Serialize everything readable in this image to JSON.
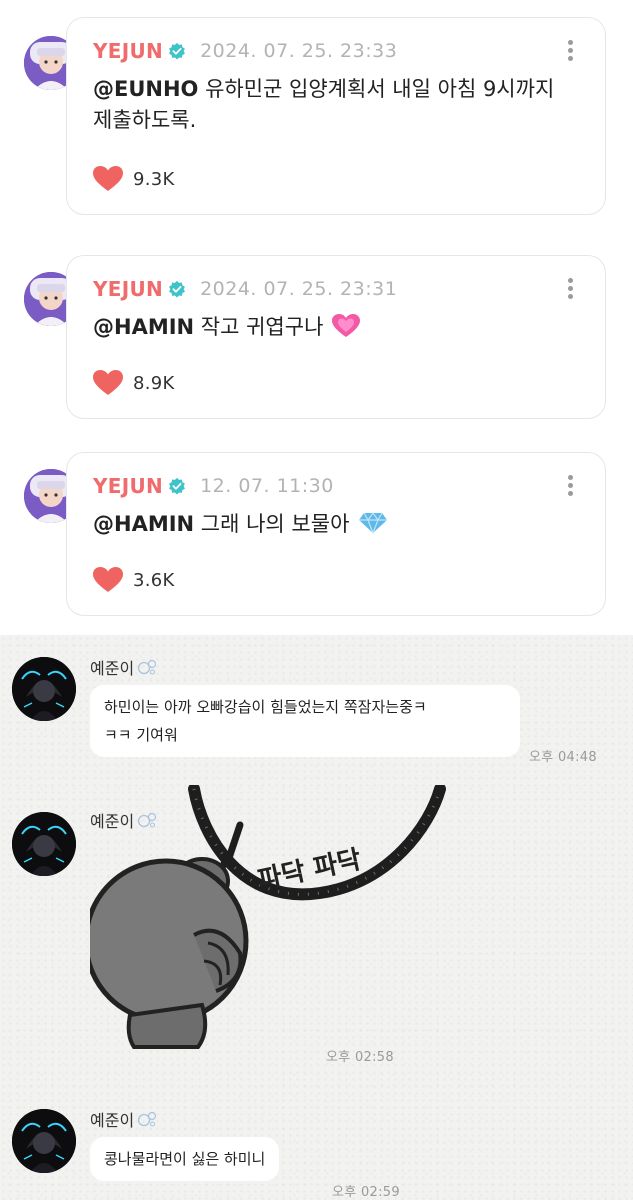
{
  "posts": [
    {
      "username": "YEJUN",
      "date": "2024. 07. 25. 23:33",
      "mention": "@EUNHO",
      "text": " 유하민군 입양계획서 내일 아침 9시까지 제출하도록.",
      "emoji": "",
      "likes": "9.3K"
    },
    {
      "username": "YEJUN",
      "date": "2024. 07. 25. 23:31",
      "mention": "@HAMIN",
      "text": " 작고 귀엽구나",
      "emoji": "pink-heart",
      "likes": "8.9K"
    },
    {
      "username": "YEJUN",
      "date": "12. 07. 11:30",
      "mention": "@HAMIN",
      "text": " 그래 나의 보물아",
      "emoji": "gem",
      "likes": "3.6K"
    }
  ],
  "chat": {
    "messages": [
      {
        "sender": "예준이",
        "text_line1": "하민이는 아까 오빠강습이 힘들었는지 쪽잠자는중ㅋ",
        "text_line2": "ㅋㅋ 기여워",
        "time": "오후 04:48"
      },
      {
        "sender": "예준이",
        "sticker": "bomb-character-sticker",
        "sticker_text": "파닥 파닥",
        "time": "오후 02:58"
      },
      {
        "sender": "예준이",
        "text_line1": "콩나물라면이 싫은 하미니",
        "time": "오후 02:59"
      }
    ]
  },
  "colors": {
    "username": "#f06b6b",
    "verified": "#3ec3c9",
    "heart": "#ef6461",
    "date": "#b3b3b3",
    "chat_bg": "#f2f2f0"
  },
  "icons": [
    "verified-badge-icon",
    "more-options-icon",
    "heart-icon",
    "pink-heart-emoji",
    "gem-emoji",
    "bubbles-emoji"
  ]
}
